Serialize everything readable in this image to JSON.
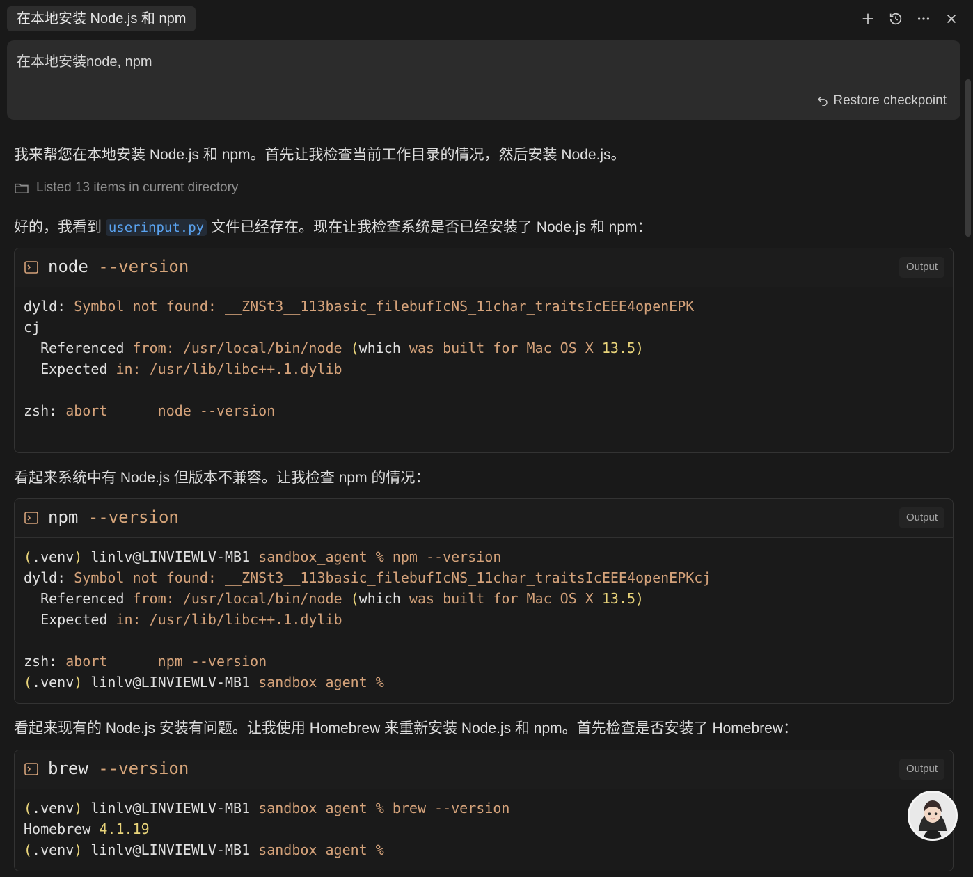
{
  "header": {
    "title": "在本地安装 Node.js 和 npm",
    "actions": [
      "plus-icon",
      "history-icon",
      "more-icon",
      "close-icon"
    ]
  },
  "prompt": {
    "text": "在本地安装node, npm",
    "restore_label": "Restore checkpoint"
  },
  "messages": {
    "intro": "我来帮您在本地安装 Node.js 和 npm。首先让我检查当前工作目录的情况，然后安装 Node.js。",
    "listed": "Listed 13 items in current directory",
    "p2_before": "好的，我看到 ",
    "p2_code": "userinput.py",
    "p2_after": " 文件已经存在。现在让我检查系统是否已经安装了 Node.js 和 npm：",
    "p3": "看起来系统中有 Node.js 但版本不兼容。让我检查 npm 的情况：",
    "p4": "看起来现有的 Node.js 安装有问题。让我使用 Homebrew 来重新安装 Node.js 和 npm。首先检查是否安装了 Homebrew："
  },
  "terminals": [
    {
      "cmd": "node",
      "flag": "--version",
      "badge": "Output",
      "lines": [
        [
          [
            "w",
            "dyld: "
          ],
          [
            "o",
            "Symbol not found: __ZNSt3__113basic_filebufIcNS_11char_traitsIcEEE4openEPK"
          ]
        ],
        [
          [
            "w",
            "cj"
          ]
        ],
        [
          [
            "w",
            "  Referenced "
          ],
          [
            "o",
            "from: /usr/local/bin/node "
          ],
          [
            "y",
            "("
          ],
          [
            "w",
            "which "
          ],
          [
            "o",
            "was built for Mac OS X "
          ],
          [
            "y",
            "13.5)"
          ]
        ],
        [
          [
            "w",
            "  Expected "
          ],
          [
            "o",
            "in: /usr/lib/libc++.1.dylib"
          ]
        ],
        [
          [
            "w",
            ""
          ]
        ],
        [
          [
            "w",
            "zsh: "
          ],
          [
            "o",
            "abort      node --version"
          ]
        ]
      ]
    },
    {
      "cmd": "npm",
      "flag": "--version",
      "badge": "Output",
      "lines": [
        [
          [
            "y",
            "("
          ],
          [
            "w",
            ".venv"
          ],
          [
            "y",
            ")"
          ],
          [
            "w",
            " linlv@LINVIEWLV-MB1 "
          ],
          [
            "o",
            "sandbox_agent % npm --version"
          ]
        ],
        [
          [
            "w",
            "dyld: "
          ],
          [
            "o",
            "Symbol not found: __ZNSt3__113basic_filebufIcNS_11char_traitsIcEEE4openEPKcj"
          ]
        ],
        [
          [
            "w",
            "  Referenced "
          ],
          [
            "o",
            "from: /usr/local/bin/node "
          ],
          [
            "y",
            "("
          ],
          [
            "w",
            "which "
          ],
          [
            "o",
            "was built for Mac OS X "
          ],
          [
            "y",
            "13.5)"
          ]
        ],
        [
          [
            "w",
            "  Expected "
          ],
          [
            "o",
            "in: /usr/lib/libc++.1.dylib"
          ]
        ],
        [
          [
            "w",
            ""
          ]
        ],
        [
          [
            "w",
            "zsh: "
          ],
          [
            "o",
            "abort      npm --version"
          ]
        ],
        [
          [
            "y",
            "("
          ],
          [
            "w",
            ".venv"
          ],
          [
            "y",
            ")"
          ],
          [
            "w",
            " linlv@LINVIEWLV-MB1 "
          ],
          [
            "o",
            "sandbox_agent %"
          ]
        ]
      ]
    },
    {
      "cmd": "brew",
      "flag": "--version",
      "badge": "Output",
      "lines": [
        [
          [
            "y",
            "("
          ],
          [
            "w",
            ".venv"
          ],
          [
            "y",
            ")"
          ],
          [
            "w",
            " linlv@LINVIEWLV-MB1 "
          ],
          [
            "o",
            "sandbox_agent % brew --version"
          ]
        ],
        [
          [
            "w",
            "Homebrew "
          ],
          [
            "y",
            "4.1.19"
          ]
        ],
        [
          [
            "y",
            "("
          ],
          [
            "w",
            ".venv"
          ],
          [
            "y",
            ")"
          ],
          [
            "w",
            " linlv@LINVIEWLV-MB1 "
          ],
          [
            "o",
            "sandbox_agent %"
          ]
        ]
      ]
    }
  ]
}
